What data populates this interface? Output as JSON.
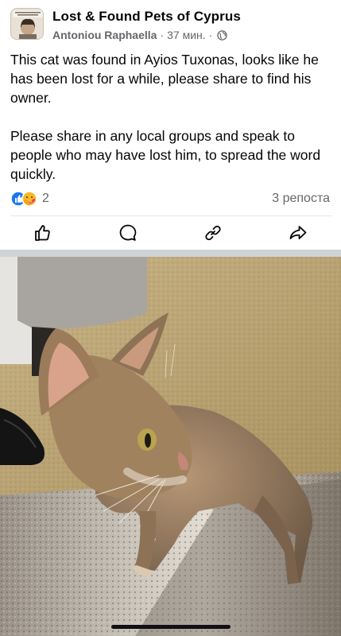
{
  "post": {
    "group_name": "Lost & Found Pets of Cyprus",
    "author": "Antoniou Raphaella",
    "separator": "·",
    "time": "37 мин.",
    "paragraph1": "This cat was found in Ayios Tuxonas, looks like he has been lost for a while, please share to find his owner.",
    "paragraph2": "Please share in any local groups and speak to people who may have lost him, to spread the word quickly.",
    "reactions": {
      "icons": [
        "like-icon",
        "care-icon"
      ],
      "count": "2"
    },
    "shares": "3 репоста",
    "audience_icon": "globe-icon"
  },
  "actions": [
    {
      "name": "like-icon"
    },
    {
      "name": "comment-icon"
    },
    {
      "name": "copy-link-icon"
    },
    {
      "name": "share-icon"
    }
  ],
  "photo": {
    "subject": "cat-photo",
    "colors": {
      "wall": "#b9a373",
      "cat": "#9a7c5c",
      "floor": "#8e8478"
    }
  }
}
